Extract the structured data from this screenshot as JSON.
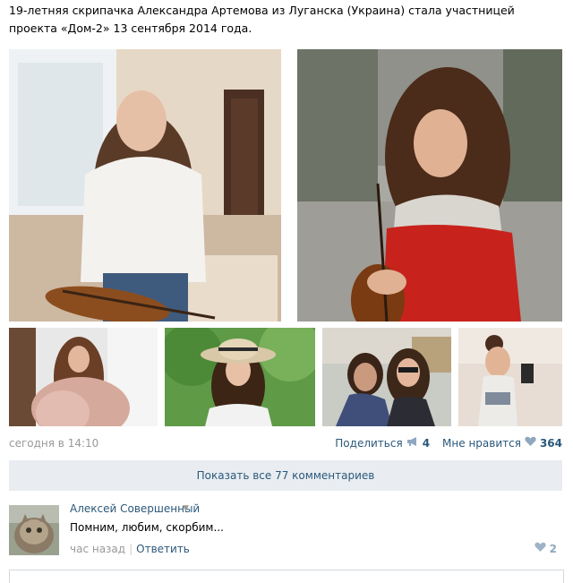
{
  "post": {
    "caption": "19-летняя скрипачка Александра Артемова из Луганска (Украина) стала участницей проекта «Дом-2» 13 сентября 2014 года.",
    "timestamp": "сегодня в 14:10",
    "share_label": "Поделиться",
    "share_count": "4",
    "like_label": "Мне нравится",
    "like_count": "364",
    "show_all_comments": "Показать все 77 комментариев"
  },
  "comment": {
    "author": "Алексей Совершенный",
    "text": "Помним, любим, скорбим...",
    "time": "час назад",
    "separator": "|",
    "reply_label": "Ответить",
    "likes": "2"
  },
  "icons": {
    "share": "megaphone-icon",
    "like": "heart-icon",
    "comment_like": "heart-icon",
    "author_menu": "chevron-down-icon"
  },
  "colors": {
    "link": "#2b587a",
    "muted": "#999999",
    "button_bg": "#e9edf1",
    "heart": "#8fa7bf"
  }
}
